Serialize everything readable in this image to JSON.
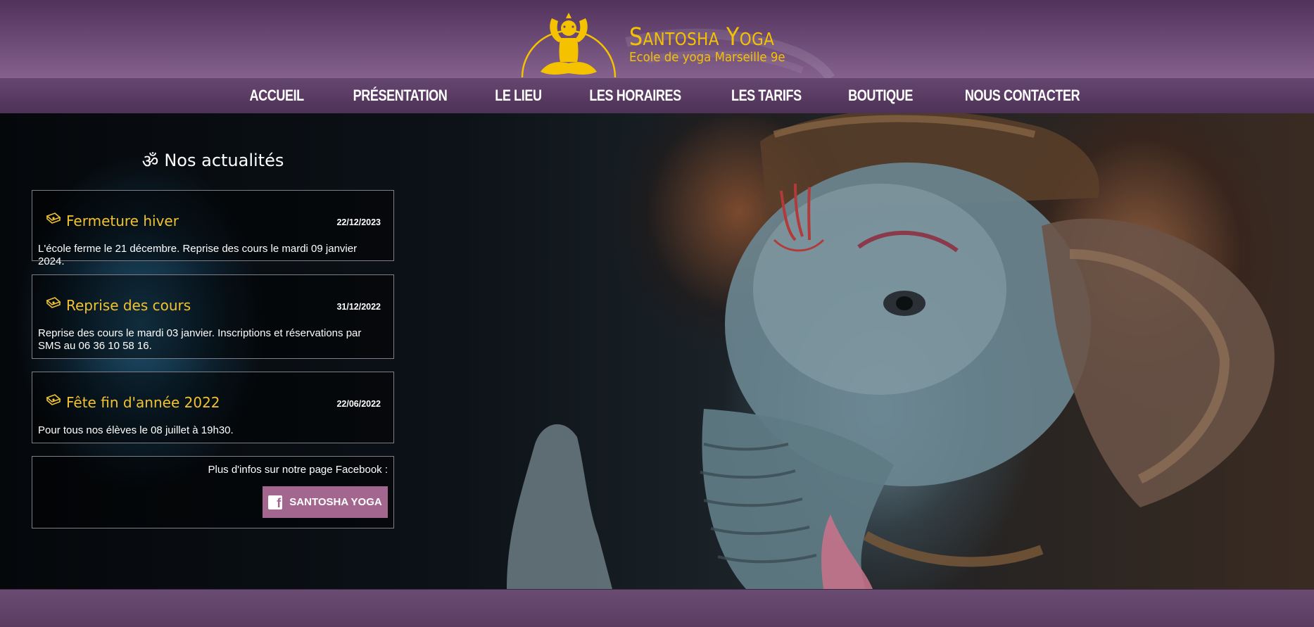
{
  "brand": {
    "title": "Santosha Yoga",
    "subtitle": "Ecole de yoga Marseille 9e",
    "accent_color": "#f5c200",
    "logo_icon": "meditating-yogi-icon"
  },
  "nav": {
    "items": [
      {
        "label": "ACCUEIL"
      },
      {
        "label": "PRÉSENTATION"
      },
      {
        "label": "LE LIEU"
      },
      {
        "label": "LES HORAIRES"
      },
      {
        "label": "LES TARIFS"
      },
      {
        "label": "BOUTIQUE"
      },
      {
        "label": "NOUS CONTACTER"
      }
    ]
  },
  "news": {
    "heading": "Nos actualités",
    "heading_icon": "om-icon",
    "items": [
      {
        "title": "Fermeture hiver",
        "date": "22/12/2023",
        "text": "L'école ferme le 21 décembre. Reprise des cours le mardi 09 janvier 2024.",
        "icon": "yoga-mat-icon"
      },
      {
        "title": "Reprise des cours",
        "date": "31/12/2022",
        "text": "Reprise des cours le mardi 03 janvier. Inscriptions et réservations par SMS au 06 36 10 58 16.",
        "icon": "yoga-mat-icon"
      },
      {
        "title": "Fête fin d'année 2022",
        "date": "22/06/2022",
        "text": "Pour tous nos élèves le 08 juillet à 19h30.",
        "icon": "yoga-mat-icon"
      }
    ]
  },
  "facebook": {
    "label": "Plus d'infos sur notre page Facebook :",
    "button_label": "SANTOSHA YOGA",
    "icon": "facebook-icon",
    "button_color": "#a3678f"
  }
}
